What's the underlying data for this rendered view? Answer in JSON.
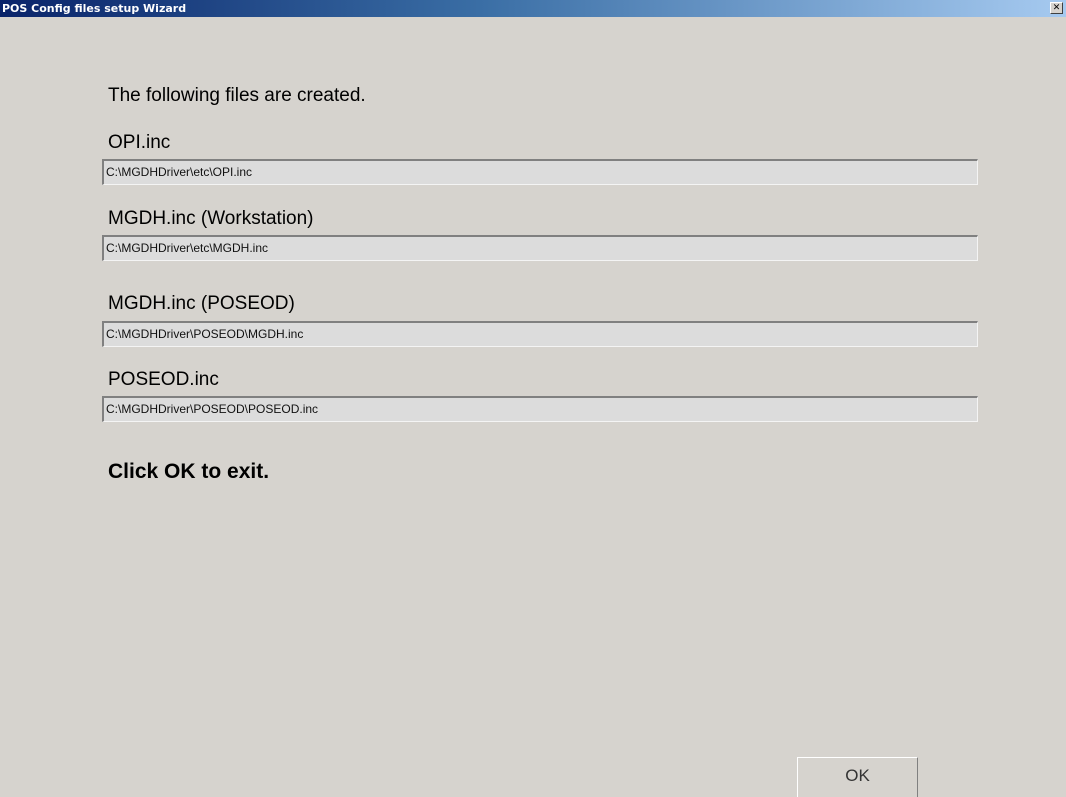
{
  "window": {
    "title": "POS Config files setup Wizard",
    "close_glyph": "✕"
  },
  "content": {
    "heading": "The following files are created.",
    "files": [
      {
        "label": "OPI.inc",
        "path": "C:\\MGDHDriver\\etc\\OPI.inc"
      },
      {
        "label": "MGDH.inc (Workstation)",
        "path": "C:\\MGDHDriver\\etc\\MGDH.inc"
      },
      {
        "label": "MGDH.inc (POSEOD)",
        "path": "C:\\MGDHDriver\\POSEOD\\MGDH.inc"
      },
      {
        "label": "POSEOD.inc",
        "path": "C:\\MGDHDriver\\POSEOD\\POSEOD.inc"
      }
    ],
    "footer": "Click OK to exit."
  },
  "buttons": {
    "ok_label": "OK"
  },
  "colors": {
    "window_bg": "#d6d3ce",
    "titlebar_start": "#0a246a",
    "titlebar_end": "#a6caf0",
    "title_text": "#ffffff"
  }
}
